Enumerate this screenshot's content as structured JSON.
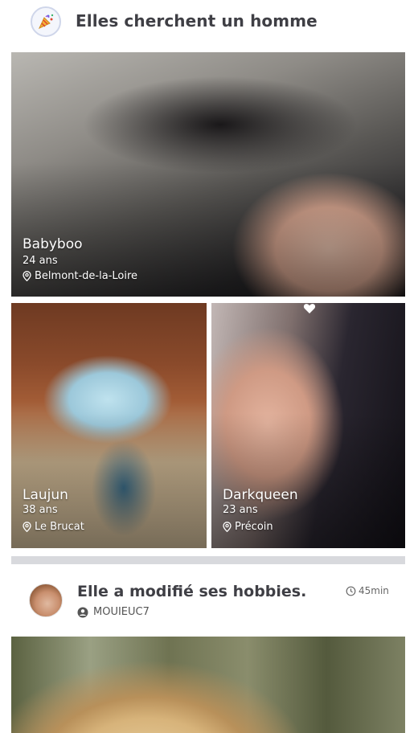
{
  "header": {
    "title": "Elles cherchent un homme",
    "icon": "party-popper-icon"
  },
  "profiles": [
    {
      "name": "Babyboo",
      "age": "24 ans",
      "location": "Belmont-de-la-Loire"
    },
    {
      "name": "Laujun",
      "age": "38 ans",
      "location": "Le Brucat"
    },
    {
      "name": "Darkqueen",
      "age": "23 ans",
      "location": "Précoin",
      "icon": "heart-icon"
    }
  ],
  "activity": {
    "title": "Elle a modifié ses hobbies.",
    "time": "45min",
    "username": "MOUIEUC7"
  },
  "colors": {
    "title_text": "#3f3f45",
    "divider": "#d8d9dd",
    "overlay_text": "#ffffff"
  }
}
